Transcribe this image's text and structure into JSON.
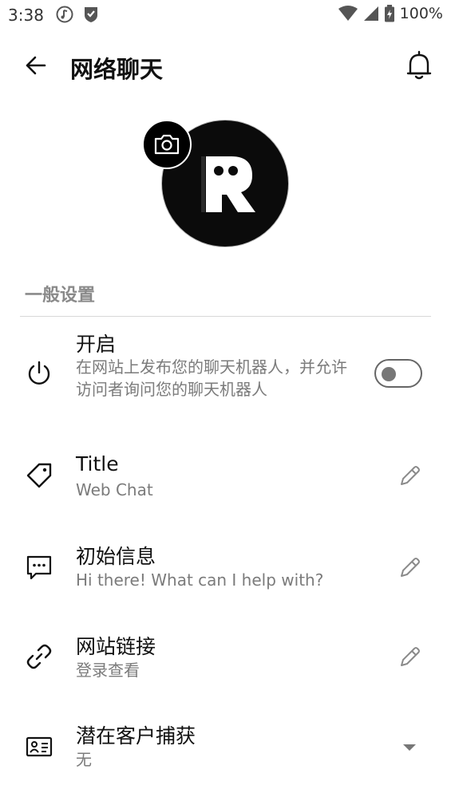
{
  "status": {
    "time": "3:38",
    "battery": "100%"
  },
  "app_bar": {
    "title": "网络聊天"
  },
  "section": {
    "general": "一般设置"
  },
  "settings": [
    {
      "title": "开启",
      "subtitle": "在网站上发布您的聊天机器人，并允许访问者询问您的聊天机器人",
      "icon": "power-icon",
      "action": "toggle",
      "enabled": false
    },
    {
      "title": "Title",
      "subtitle": "Web Chat",
      "icon": "tag-icon",
      "action": "edit"
    },
    {
      "title": "初始信息",
      "subtitle": "Hi there! What can I help with?",
      "icon": "chat-bubble-icon",
      "action": "edit"
    },
    {
      "title": "网站链接",
      "subtitle": "登录查看",
      "icon": "link-icon",
      "action": "edit"
    },
    {
      "title": "潜在客户捕获",
      "subtitle": "无",
      "icon": "contact-card-icon",
      "action": "dropdown"
    }
  ],
  "colors": {
    "background": "#ffffff",
    "text": "#111111",
    "secondary_text": "#7b7b7b",
    "avatar_bg": "#0b0b0b"
  }
}
